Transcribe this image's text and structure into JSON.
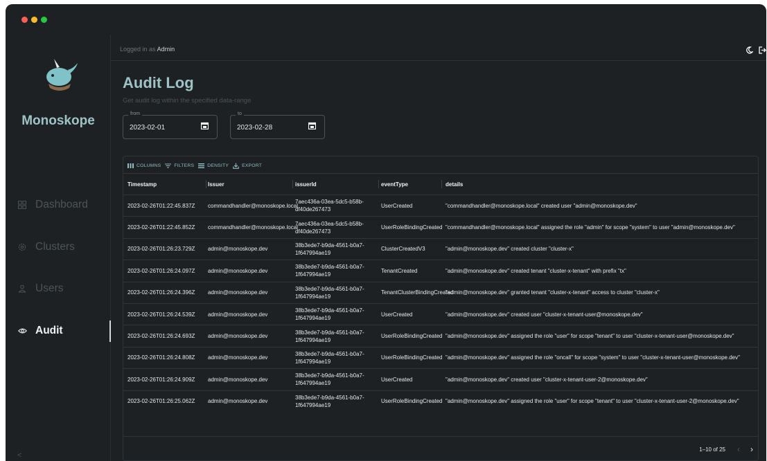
{
  "window": {
    "traffic_lights": [
      "close",
      "minimize",
      "maximize"
    ]
  },
  "sidebar": {
    "brand": "Monoskope",
    "items": [
      {
        "label": "Dashboard",
        "icon": "dashboard-icon",
        "active": false
      },
      {
        "label": "Clusters",
        "icon": "gear-icon",
        "active": false
      },
      {
        "label": "Users",
        "icon": "user-icon",
        "active": false
      },
      {
        "label": "Audit",
        "icon": "eye-icon",
        "active": true
      }
    ],
    "collapse_label": "<"
  },
  "header": {
    "logged_in_prefix": "Logged in as",
    "username": "Admin",
    "icons": [
      "theme-toggle-icon",
      "logout-icon"
    ]
  },
  "page": {
    "title": "Audit Log",
    "subtitle": "Get audit log within the specified data-range",
    "from": {
      "label": "from",
      "value": "2023-02-01"
    },
    "to": {
      "label": "to",
      "value": "2023-02-28"
    }
  },
  "grid": {
    "toolbar": [
      "COLUMNS",
      "FILTERS",
      "DENSITY",
      "EXPORT"
    ],
    "columns": [
      "Timestamp",
      "Issuer",
      "issuerId",
      "eventType",
      "details"
    ],
    "rows": [
      [
        "2023-02-26T01:22:45.837Z",
        "commandhandler@monoskope.local",
        "7aec436a-03ea-5dc5-b58b-df40de267473",
        "UserCreated",
        "\"commandhandler@monoskope.local\" created user \"admin@monoskope.dev\""
      ],
      [
        "2023-02-26T01:22:45.852Z",
        "commandhandler@monoskope.local",
        "7aec436a-03ea-5dc5-b58b-df40de267473",
        "UserRoleBindingCreated",
        "\"commandhandler@monoskope.local\" assigned the role \"admin\" for scope \"system\" to user \"admin@monoskope.dev\""
      ],
      [
        "2023-02-26T01:26:23.729Z",
        "admin@monoskope.dev",
        "38b3ede7-b9da-4561-b0a7-1f647994ae19",
        "ClusterCreatedV3",
        "\"admin@monoskope.dev\" created cluster \"cluster-x\""
      ],
      [
        "2023-02-26T01:26:24.097Z",
        "admin@monoskope.dev",
        "38b3ede7-b9da-4561-b0a7-1f647994ae19",
        "TenantCreated",
        "\"admin@monoskope.dev\" created tenant \"cluster-x-tenant\" with prefix \"tx\""
      ],
      [
        "2023-02-26T01:26:24.396Z",
        "admin@monoskope.dev",
        "38b3ede7-b9da-4561-b0a7-1f647994ae19",
        "TenantClusterBindingCreated",
        "\"admin@monoskope.dev\" granted tenant \"cluster-x-tenant\" access to cluster \"cluster-x\""
      ],
      [
        "2023-02-26T01:26:24.539Z",
        "admin@monoskope.dev",
        "38b3ede7-b9da-4561-b0a7-1f647994ae19",
        "UserCreated",
        "\"admin@monoskope.dev\" created user \"cluster-x-tenant-user@monoskope.dev\""
      ],
      [
        "2023-02-26T01:26:24.693Z",
        "admin@monoskope.dev",
        "38b3ede7-b9da-4561-b0a7-1f647994ae19",
        "UserRoleBindingCreated",
        "\"admin@monoskope.dev\" assigned the role \"user\" for scope \"tenant\" to user \"cluster-x-tenant-user@monoskope.dev\""
      ],
      [
        "2023-02-26T01:26:24.808Z",
        "admin@monoskope.dev",
        "38b3ede7-b9da-4561-b0a7-1f647994ae19",
        "UserRoleBindingCreated",
        "\"admin@monoskope.dev\" assigned the role \"oncall\" for scope \"system\" to user \"cluster-x-tenant-user@monoskope.dev\""
      ],
      [
        "2023-02-26T01:26:24.909Z",
        "admin@monoskope.dev",
        "38b3ede7-b9da-4561-b0a7-1f647994ae19",
        "UserCreated",
        "\"admin@monoskope.dev\" created user \"cluster-x-tenant-user-2@monoskope.dev\""
      ],
      [
        "2023-02-26T01:26:25.062Z",
        "admin@monoskope.dev",
        "38b3ede7-b9da-4561-b0a7-1f647994ae19",
        "UserRoleBindingCreated",
        "\"admin@monoskope.dev\" assigned the role \"user\" for scope \"tenant\" to user \"cluster-x-tenant-user-2@monoskope.dev\""
      ]
    ],
    "pagination": "1–10 of 25"
  },
  "colors": {
    "background": "#1d2124",
    "accent": "#9ec3c6",
    "muted": "#4c5458"
  }
}
